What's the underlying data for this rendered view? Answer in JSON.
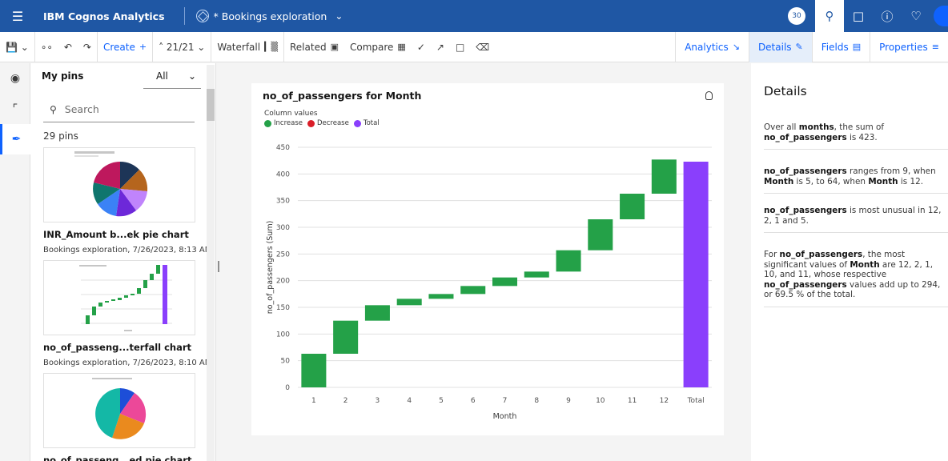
{
  "topbar": {
    "brand": "IBM Cognos Analytics",
    "doc_title": "* Bookings exploration",
    "badge": "30"
  },
  "toolbar": {
    "create": "Create",
    "counter": "21/21",
    "waterfall": "Waterfall",
    "related": "Related",
    "compare": "Compare",
    "tabs": {
      "analytics": "Analytics",
      "details": "Details",
      "fields": "Fields",
      "properties": "Properties"
    }
  },
  "pins": {
    "title": "My pins",
    "filter": "All",
    "search_placeholder": "Search",
    "count": "29 pins",
    "items": [
      {
        "name": "INR_Amount b...ek pie chart",
        "meta": "Bookings exploration, 7/26/2023, 8:13 AM"
      },
      {
        "name": "no_of_passeng...terfall chart",
        "meta": "Bookings exploration, 7/26/2023, 8:10 AM"
      },
      {
        "name": "no_of_passeng...ed pie chart",
        "meta": ""
      }
    ]
  },
  "chart_data": {
    "type": "bar",
    "subtype": "waterfall",
    "title": "no_of_passengers for Month",
    "legend_title": "Column values",
    "legend": [
      "Increase",
      "Decrease",
      "Total"
    ],
    "xlabel": "Month",
    "ylabel": "no_of_passengers (Sum)",
    "categories": [
      "1",
      "2",
      "3",
      "4",
      "5",
      "6",
      "7",
      "8",
      "9",
      "10",
      "11",
      "12",
      "Total"
    ],
    "values": [
      63,
      62,
      29,
      12,
      9,
      15,
      16,
      11,
      40,
      58,
      48,
      64,
      423
    ],
    "ylim": [
      0,
      450
    ],
    "yticks": [
      0,
      50,
      100,
      150,
      200,
      250,
      300,
      350,
      400,
      450
    ],
    "colors": {
      "increase": "#24a148",
      "decrease": "#da1e28",
      "total": "#8a3ffc"
    },
    "grid": true
  },
  "details": {
    "title": "Details",
    "insights": [
      {
        "p1": "Over all ",
        "b1": "months",
        "p2": ", the sum of ",
        "b2": "no_of_passengers",
        "p3": " is 423."
      },
      {
        "b1": "no_of_passengers",
        "p1": " ranges from 9, when ",
        "b2": "Month",
        "p2": " is 5, to 64, when ",
        "b3": "Month",
        "p3": " is 12."
      },
      {
        "b1": "no_of_passengers",
        "p1": " is most unusual in 12, 2, 1 and 5."
      },
      {
        "p1": "For ",
        "b1": "no_of_passengers",
        "p2": ", the most significant values of ",
        "b2": "Month",
        "p3": " are 12, 2, 1, 10, and 11, whose respective ",
        "b3": "no_of_passengers",
        "p4": " values add up to 294, or 69.5 % of the total."
      }
    ]
  }
}
